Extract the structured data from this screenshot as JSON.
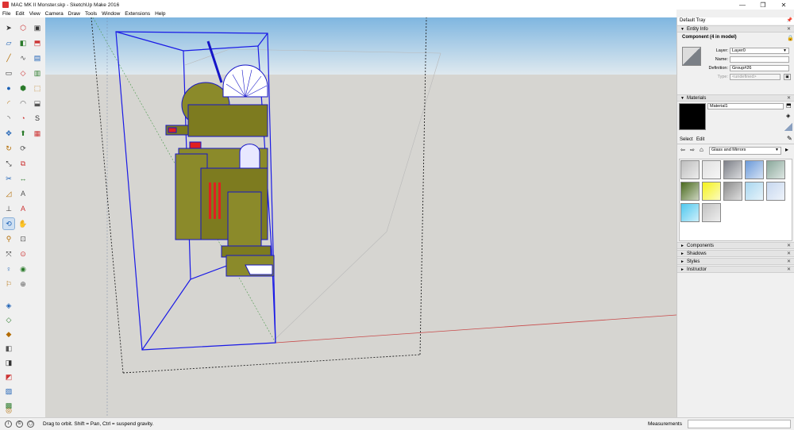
{
  "window": {
    "title": "MAC MK II Monster.skp - SketchUp Make 2016",
    "minimize": "—",
    "maximize": "❐",
    "close": "✕"
  },
  "menu": [
    "File",
    "Edit",
    "View",
    "Camera",
    "Draw",
    "Tools",
    "Window",
    "Extensions",
    "Help"
  ],
  "toolbar_icons": [
    "select-icon",
    "component-icon",
    "eraser-icon",
    "paint-bucket-icon",
    "line-icon",
    "freehand-icon",
    "rectangle-icon",
    "rotated-rectangle-icon",
    "circle-icon",
    "polygon-icon",
    "arc-icon",
    "two-point-arc-icon",
    "three-point-arc-icon",
    "pie-icon",
    "move-icon",
    "push-pull-icon",
    "rotate-icon",
    "follow-me-icon",
    "scale-icon",
    "offset-icon",
    "tape-measure-icon",
    "dimension-icon",
    "protractor-icon",
    "text-icon",
    "axes-icon",
    "3d-text-icon",
    "orbit-icon",
    "pan-icon",
    "zoom-icon",
    "zoom-window-icon",
    "zoom-extents-icon",
    "previous-view-icon",
    "position-camera-icon",
    "look-around-icon",
    "walk-icon",
    "section-plane-icon",
    "warehouse-icon",
    "share-model-icon",
    "components-warehouse-icon",
    "extension-warehouse-icon",
    "layout-icon",
    "style-builder-icon",
    "stl-icon",
    "calculator-icon",
    "iso-view-icon",
    "top-view-icon",
    "front-view-icon",
    "right-view-icon",
    "back-view-icon",
    "left-view-icon",
    "xray-icon",
    "shaded-icon",
    "ruby-console-icon"
  ],
  "tray": {
    "title": "Default Tray",
    "entity_info": {
      "header": "Entity Info",
      "summary": "Component (4 in model)",
      "layer_label": "Layer:",
      "layer_value": "Layer0",
      "name_label": "Name:",
      "name_value": "",
      "definition_label": "Definition:",
      "definition_value": "Group#26",
      "type_label": "Type:",
      "type_value": "<undefined>"
    },
    "materials": {
      "header": "Materials",
      "current_name": "Material1",
      "current_color": "#000000",
      "tab_select": "Select",
      "tab_edit": "Edit",
      "collection": "Glass and Mirrors",
      "swatch_colors": [
        "#bdbdbd",
        "#e0e0e0",
        "#7d8088",
        "#6b9ad9",
        "#8aa89b",
        "#4a6a1e",
        "#f4f21b",
        "#8c8c8c",
        "#a9d6ef",
        "#c6d7ef",
        "#4fc7ee",
        "#c2c2c2"
      ]
    },
    "collapsed_panels": [
      "Components",
      "Shadows",
      "Styles",
      "Instructor"
    ]
  },
  "status": {
    "hint": "Drag to orbit. Shift = Pan, Ctrl = suspend gravity.",
    "measurements_label": "Measurements",
    "measurements_value": ""
  }
}
